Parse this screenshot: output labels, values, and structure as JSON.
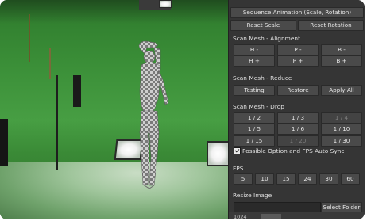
{
  "panel": {
    "sequence_animation": "Sequence Animation (Scale, Rotation)",
    "reset_scale": "Reset Scale",
    "reset_rotation": "Reset Rotation",
    "alignment": {
      "title": "Scan Mesh - Alignment",
      "buttons": [
        "H -",
        "P -",
        "B -",
        "H +",
        "P +",
        "B +"
      ]
    },
    "reduce": {
      "title": "Scan Mesh - Reduce",
      "buttons": [
        "Testing",
        "Restore",
        "Apply All"
      ]
    },
    "drop": {
      "title": "Scan Mesh - Drop",
      "buttons": [
        "1 / 2",
        "1 / 3",
        "1 / 4",
        "1 / 5",
        "1 / 6",
        "1 / 10",
        "1 / 15",
        "1 / 20",
        "1 / 30"
      ]
    },
    "possible_option": "Possible Option and FPS Auto Sync",
    "fps": {
      "title": "FPS",
      "buttons": [
        "5",
        "10",
        "15",
        "24",
        "30",
        "60"
      ]
    },
    "resize": {
      "title": "Resize Image",
      "select_folder": "Select Folder"
    },
    "bottom_value": "1024"
  }
}
